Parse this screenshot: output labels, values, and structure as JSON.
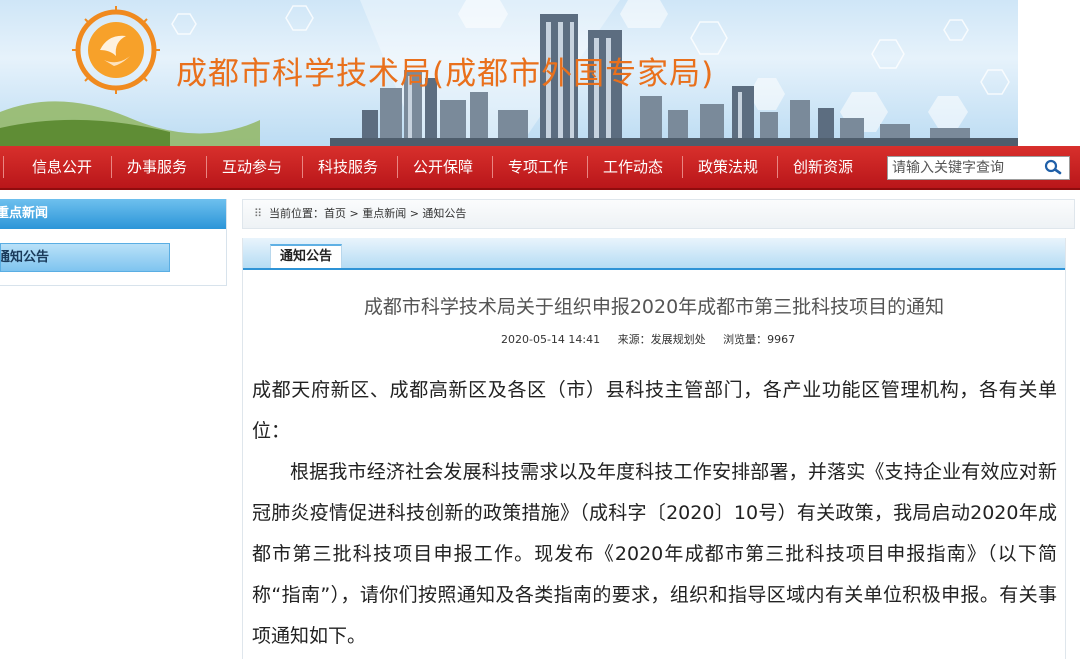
{
  "header": {
    "site_title": "成都市科学技术局(成都市外国专家局)"
  },
  "nav": {
    "items": [
      "信息公开",
      "办事服务",
      "互动参与",
      "科技服务",
      "公开保障",
      "专项工作",
      "工作动态",
      "政策法规",
      "创新资源"
    ],
    "search_placeholder": "请输入关键字查询"
  },
  "sidebar": {
    "header": "重点新闻",
    "items": [
      "通知公告"
    ]
  },
  "breadcrumb": {
    "text": "当前位置：首页 > 重点新闻 > 通知公告"
  },
  "panel": {
    "tab_label": "通知公告"
  },
  "article": {
    "title": "成都市科学技术局关于组织申报2020年成都市第三批科技项目的通知",
    "date": "2020-05-14 14:41",
    "source": "来源：发展规划处",
    "views": "浏览量：9967",
    "paragraphs": [
      "成都天府新区、成都高新区及各区（市）县科技主管部门，各产业功能区管理机构，各有关单位：",
      "根据我市经济社会发展科技需求以及年度科技工作安排部署，并落实《支持企业有效应对新冠肺炎疫情促进科技创新的政策措施》（成科字〔2020〕10号）有关政策，我局启动2020年成都市第三批科技项目申报工作。现发布《2020年成都市第三批科技项目申报指南》（以下简称“指南”），请你们按照通知及各类指南的要求，组织和指导区域内有关单位积极申报。有关事项通知如下。"
    ]
  },
  "colors": {
    "nav_red": "#c81f22",
    "title_orange": "#e9701c",
    "accent_blue": "#2e93d6"
  }
}
